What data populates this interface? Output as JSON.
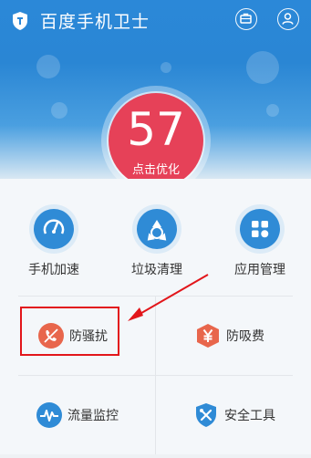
{
  "app": {
    "title": "百度手机卫士"
  },
  "score": {
    "value": "57",
    "label": "点击优化"
  },
  "tools": [
    {
      "label": "手机加速",
      "icon": "speedometer-icon"
    },
    {
      "label": "垃圾清理",
      "icon": "recycle-icon"
    },
    {
      "label": "应用管理",
      "icon": "app-grid-icon"
    }
  ],
  "features": [
    {
      "label": "防骚扰",
      "icon": "phone-block-icon",
      "color": "#e8664c"
    },
    {
      "label": "防吸费",
      "icon": "yen-shield-icon",
      "color": "#e8664c"
    },
    {
      "label": "流量监控",
      "icon": "pulse-icon",
      "color": "#2f8bd6"
    },
    {
      "label": "安全工具",
      "icon": "tools-shield-icon",
      "color": "#2f8bd6"
    }
  ],
  "colors": {
    "header_blue": "#2b88d8",
    "score_red": "#e64158",
    "annotation_red": "#e2161b"
  }
}
